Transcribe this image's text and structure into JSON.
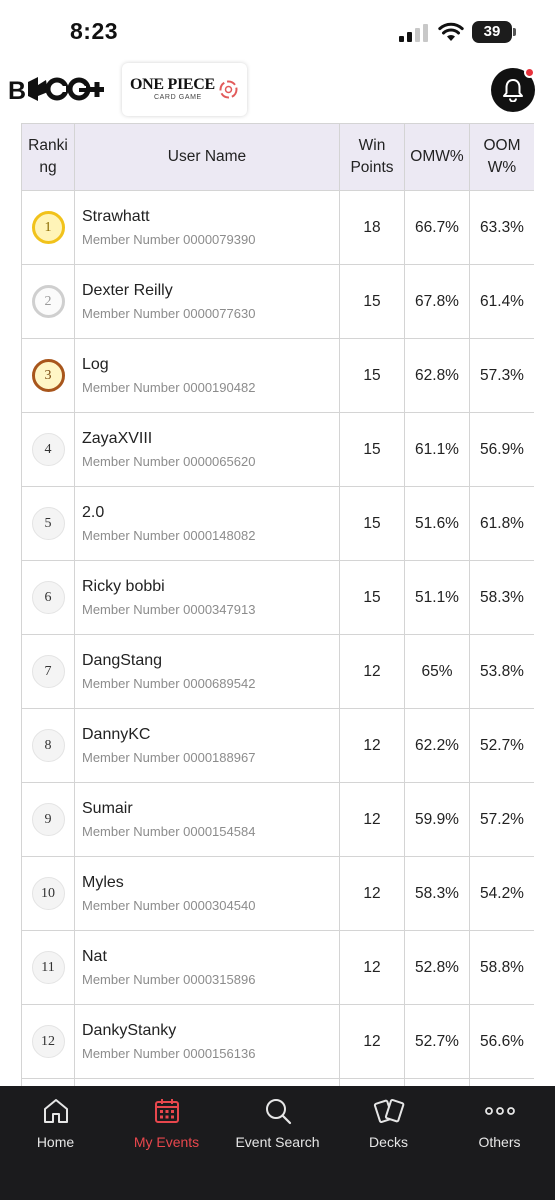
{
  "status_bar": {
    "time": "8:23",
    "battery": "39"
  },
  "header": {
    "brand_logo": "B-TCG+",
    "game_logo_title": "ONE PIECE",
    "game_logo_subtitle": "CARD GAME",
    "notification_icon": "bell-icon"
  },
  "table": {
    "headers": {
      "ranking": "Ranking",
      "user_name": "User Name",
      "win_points": "Win Points",
      "omw": "OMW%",
      "oomw": "OOMW%"
    },
    "rows": [
      {
        "rank": "1",
        "name": "Strawhatt",
        "member": "Member Number 0000079390",
        "win_points": "18",
        "omw": "66.7%",
        "oomw": "63.3%"
      },
      {
        "rank": "2",
        "name": "Dexter Reilly",
        "member": "Member Number 0000077630",
        "win_points": "15",
        "omw": "67.8%",
        "oomw": "61.4%"
      },
      {
        "rank": "3",
        "name": "Log",
        "member": "Member Number 0000190482",
        "win_points": "15",
        "omw": "62.8%",
        "oomw": "57.3%"
      },
      {
        "rank": "4",
        "name": "ZayaXVIII",
        "member": "Member Number 0000065620",
        "win_points": "15",
        "omw": "61.1%",
        "oomw": "56.9%"
      },
      {
        "rank": "5",
        "name": "2.0",
        "member": "Member Number 0000148082",
        "win_points": "15",
        "omw": "51.6%",
        "oomw": "61.8%"
      },
      {
        "rank": "6",
        "name": "Ricky bobbi",
        "member": "Member Number 0000347913",
        "win_points": "15",
        "omw": "51.1%",
        "oomw": "58.3%"
      },
      {
        "rank": "7",
        "name": "DangStang",
        "member": "Member Number 0000689542",
        "win_points": "12",
        "omw": "65%",
        "oomw": "53.8%"
      },
      {
        "rank": "8",
        "name": "DannyKC",
        "member": "Member Number 0000188967",
        "win_points": "12",
        "omw": "62.2%",
        "oomw": "52.7%"
      },
      {
        "rank": "9",
        "name": "Sumair",
        "member": "Member Number 0000154584",
        "win_points": "12",
        "omw": "59.9%",
        "oomw": "57.2%"
      },
      {
        "rank": "10",
        "name": "Myles",
        "member": "Member Number 0000304540",
        "win_points": "12",
        "omw": "58.3%",
        "oomw": "54.2%"
      },
      {
        "rank": "11",
        "name": "Nat",
        "member": "Member Number 0000315896",
        "win_points": "12",
        "omw": "52.8%",
        "oomw": "58.8%"
      },
      {
        "rank": "12",
        "name": "DankyStanky",
        "member": "Member Number 0000156136",
        "win_points": "12",
        "omw": "52.7%",
        "oomw": "56.6%"
      }
    ]
  },
  "bottom_nav": {
    "items": [
      {
        "label": "Home",
        "icon": "home-icon",
        "active": false
      },
      {
        "label": "My Events",
        "icon": "calendar-icon",
        "active": true
      },
      {
        "label": "Event Search",
        "icon": "search-icon",
        "active": false
      },
      {
        "label": "Decks",
        "icon": "cards-icon",
        "active": false
      },
      {
        "label": "Others",
        "icon": "more-icon",
        "active": false
      }
    ]
  },
  "colors": {
    "active_nav": "#e8474d",
    "nav_background": "#1b1b1d",
    "table_header_bg": "#ece9f3",
    "gold_medal": "#f1c21b",
    "silver_medal": "#cfcfcf",
    "bronze_medal": "#a8561c",
    "notification_dot": "#e8323c"
  }
}
